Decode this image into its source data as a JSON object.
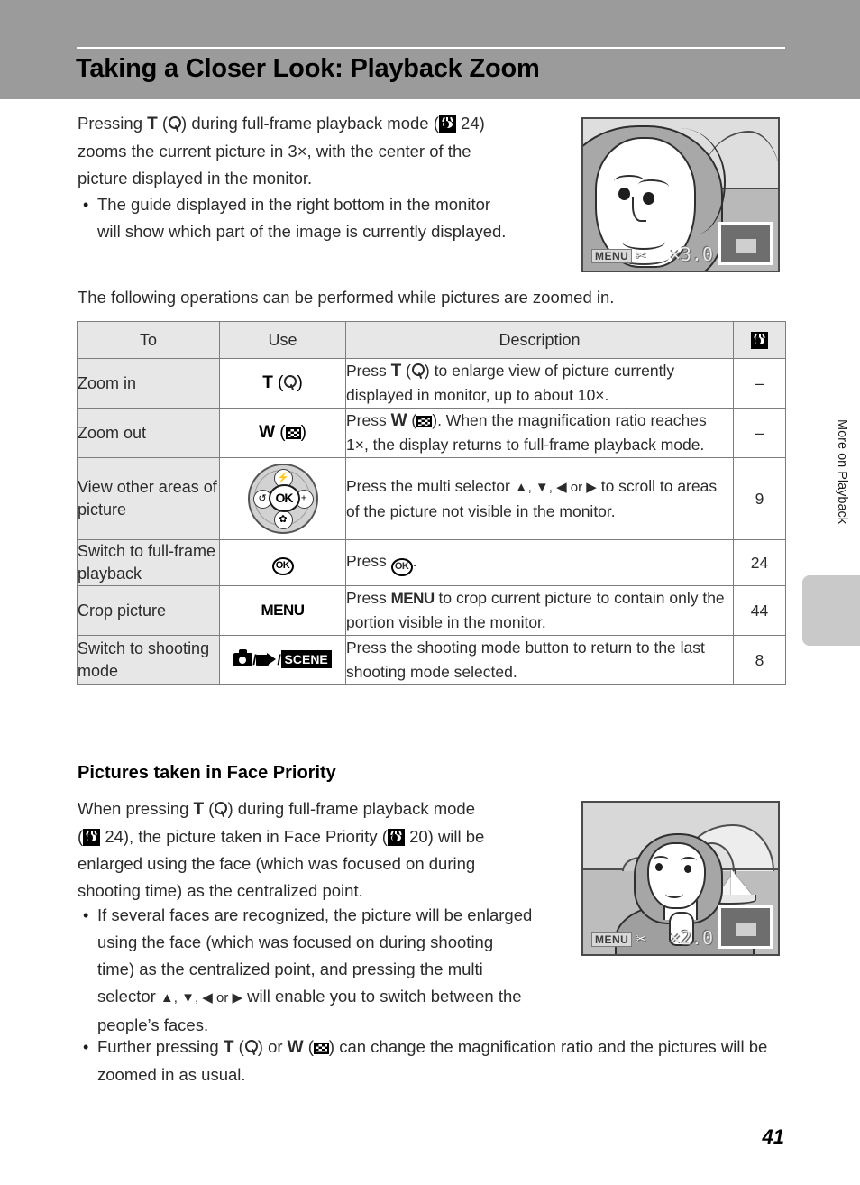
{
  "header": {
    "title": "Taking a Closer Look: Playback Zoom"
  },
  "intro": {
    "p1_a": "Pressing ",
    "p1_t": "T",
    "p1_b": ") during full-frame playback mode (",
    "p1_ref": "24",
    "p1_c": ")",
    "p1_line2": "zooms the current picture in 3×, with the center of the",
    "p1_line3": "picture displayed in the monitor.",
    "bullet1": "The guide displayed in the right bottom in the monitor will show which part of the image is currently displayed.",
    "p2": "The following operations can be performed while pictures are zoomed in."
  },
  "table": {
    "headers": [
      "To",
      "Use",
      "Description",
      "see-also-eye-icon"
    ],
    "rows": [
      {
        "to": "Zoom in",
        "use_label": "T",
        "use_icon": "magnifier-icon",
        "desc_a": "Press ",
        "desc_t": "T",
        "desc_b": ") to enlarge view of picture currently displayed in monitor, up to about 10×.",
        "ref": "–"
      },
      {
        "to": "Zoom out",
        "use_label": "W",
        "use_icon": "thumbnail-grid-icon",
        "desc_a": "Press ",
        "desc_w": "W",
        "desc_b": "). When the magnification ratio reaches 1×, the display returns to full-frame playback mode.",
        "ref": "–"
      },
      {
        "to": "View other areas of picture",
        "use_icon": "multi-selector-dial-icon",
        "desc_a": "Press the multi selector ",
        "desc_arrows": "▲, ▼, ◀ or ▶",
        "desc_b": " to scroll to areas of the picture not visible in the monitor.",
        "ref": "9"
      },
      {
        "to": "Switch to full-frame playback",
        "use_icon": "ok-button-icon",
        "desc_a": "Press ",
        "desc_b": ".",
        "ref": "24"
      },
      {
        "to": "Crop picture",
        "use_label": "MENU",
        "desc_a": "Press ",
        "desc_menu": "MENU",
        "desc_b": " to crop current picture to contain only the portion visible in the monitor.",
        "ref": "44"
      },
      {
        "to": "Switch to shooting mode",
        "use_icon": "camera-movie-scene-icons",
        "use_scene_label": "SCENE",
        "desc_a": "Press the shooting mode button to return to the last shooting mode selected.",
        "ref": "8"
      }
    ]
  },
  "face_priority": {
    "heading": "Pictures taken in Face Priority",
    "p_a": "When pressing ",
    "p_t": "T",
    "p_b": ") during full-frame playback mode",
    "p_c": "24), the picture taken in Face Priority (",
    "p_ref2": "20",
    "p_d": ") will be",
    "p_line3": "enlarged using the face (which was focused on during",
    "p_line4": "shooting time) as the centralized point.",
    "bullet1_a": "If several faces are recognized, the picture will be enlarged using the face (which was focused on during shooting time) as the centralized point, and pressing the multi selector ",
    "bullet1_arrows": "▲, ▼, ◀ or ▶",
    "bullet1_b": " will enable you to switch between the people’s faces.",
    "bullet2_a": "Further pressing ",
    "bullet2_t": "T",
    "bullet2_mid": ") or ",
    "bullet2_w": "W",
    "bullet2_b": ") can change the magnification ratio and the pictures will be zoomed in as usual."
  },
  "illustrations": {
    "top_screen": {
      "menu_label": "MENU",
      "crop_icon": "scissors-icon",
      "zoom_ratio": "×3.0",
      "guide": "navigation-guide-box"
    },
    "bottom_screen": {
      "menu_label": "MENU",
      "crop_icon": "scissors-icon",
      "zoom_ratio": "×2.0",
      "guide": "navigation-guide-box"
    }
  },
  "side_tab": {
    "label": "More on Playback"
  },
  "page_number": "41"
}
